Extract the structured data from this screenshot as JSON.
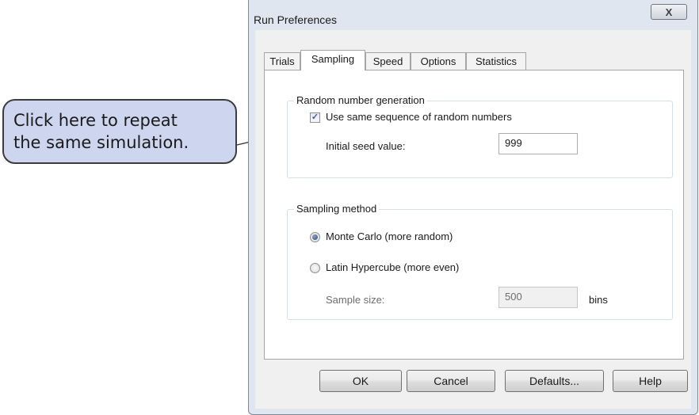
{
  "callout": {
    "line1": "Click here to repeat",
    "line2": "the same simulation."
  },
  "window": {
    "title": "Run Preferences",
    "close_glyph": "X"
  },
  "tabs": [
    {
      "label": "Trials",
      "active": false
    },
    {
      "label": "Sampling",
      "active": true
    },
    {
      "label": "Speed",
      "active": false
    },
    {
      "label": "Options",
      "active": false
    },
    {
      "label": "Statistics",
      "active": false
    }
  ],
  "random_group": {
    "title": "Random number generation",
    "checkbox_label": "Use same sequence of random numbers",
    "checkbox_checked": true,
    "seed_label": "Initial seed value:",
    "seed_value": "999"
  },
  "sampling_group": {
    "title": "Sampling method",
    "options": [
      {
        "label": "Monte Carlo  (more random)",
        "checked": true
      },
      {
        "label": "Latin Hypercube  (more even)",
        "checked": false
      }
    ],
    "sample_size_label": "Sample size:",
    "sample_size_value": "500",
    "unit": "bins"
  },
  "buttons": {
    "ok": "OK",
    "cancel": "Cancel",
    "defaults": "Defaults...",
    "help": "Help"
  },
  "icons": {
    "checkmark": "✓"
  }
}
